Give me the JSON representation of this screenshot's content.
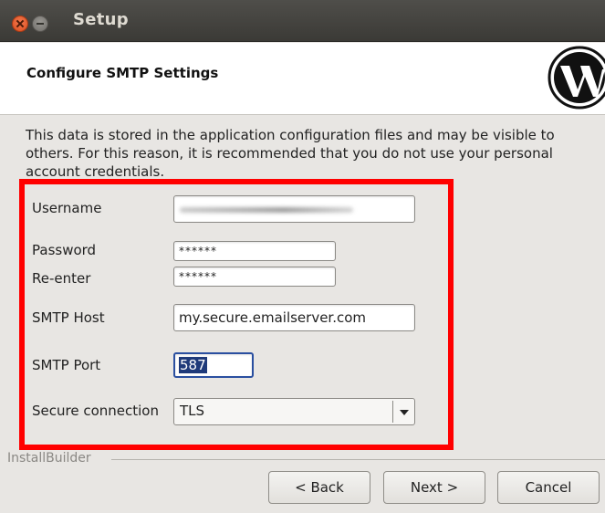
{
  "window": {
    "title": "Setup"
  },
  "header": {
    "title": "Configure SMTP Settings",
    "logo_icon": "wordpress-logo-icon"
  },
  "description": "This data is stored in the application configuration files and may be visible to others. For this reason, it is recommended that you do not use your personal account credentials.",
  "form": {
    "username_label": "Username",
    "password_label": "Password",
    "password_value": "******",
    "reenter_label": "Re-enter",
    "reenter_value": "******",
    "host_label": "SMTP Host",
    "host_value": "my.secure.emailserver.com",
    "port_label": "SMTP Port",
    "port_value": "587",
    "secure_label": "Secure connection",
    "secure_value": "TLS"
  },
  "footer": {
    "brand": "InstallBuilder",
    "back_label": "< Back",
    "next_label": "Next >",
    "cancel_label": "Cancel"
  },
  "colors": {
    "highlight": "#ff0000",
    "titlebar": "#3f3e3a",
    "selection": "#1f3a7a"
  }
}
